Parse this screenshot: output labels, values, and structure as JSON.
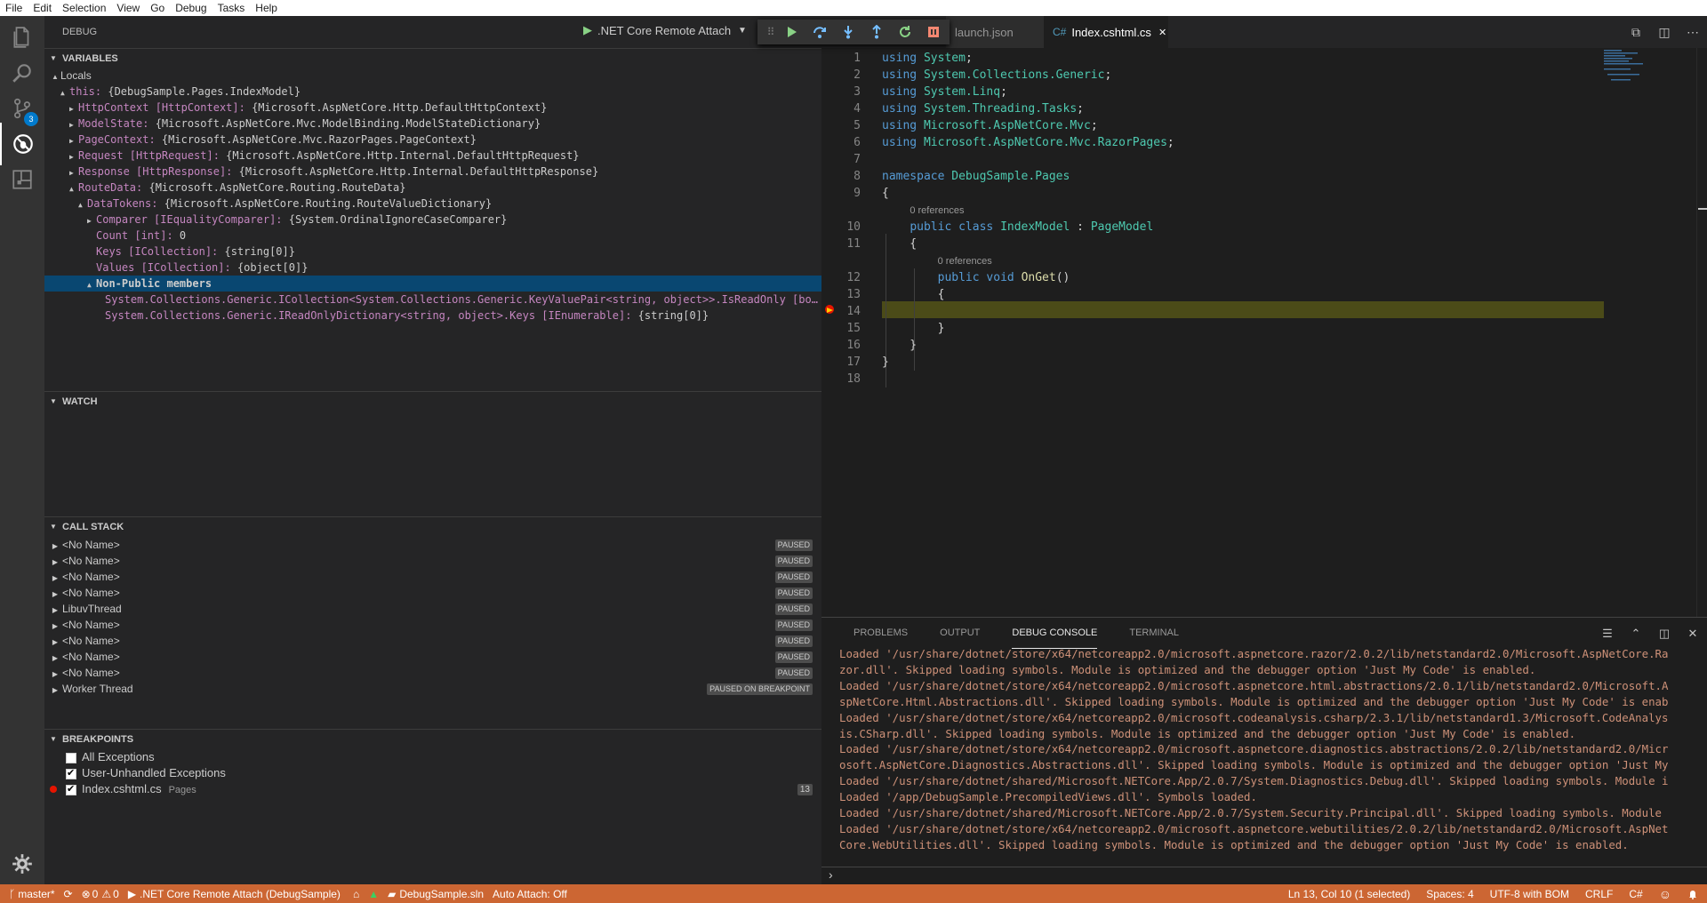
{
  "menu": [
    "File",
    "Edit",
    "Selection",
    "View",
    "Go",
    "Debug",
    "Tasks",
    "Help"
  ],
  "activity": {
    "scm_badge": "3"
  },
  "sidebar": {
    "title": "DEBUG",
    "launch_config": ".NET Core Remote Attach",
    "sections": {
      "variables": "VARIABLES",
      "watch": "WATCH",
      "callstack": "CALL STACK",
      "breakpoints": "BREAKPOINTS"
    },
    "variables": [
      {
        "indent": 0,
        "twisty": "▲",
        "name": "Locals",
        "value": "",
        "style": "scope"
      },
      {
        "indent": 1,
        "twisty": "▲",
        "name": "this:",
        "value": " {DebugSample.Pages.IndexModel}",
        "style": "prop"
      },
      {
        "indent": 2,
        "twisty": "▶",
        "name": "HttpContext [HttpContext]:",
        "value": " {Microsoft.AspNetCore.Http.DefaultHttpContext}",
        "style": "prop"
      },
      {
        "indent": 2,
        "twisty": "▶",
        "name": "ModelState:",
        "value": " {Microsoft.AspNetCore.Mvc.ModelBinding.ModelStateDictionary}",
        "style": "prop"
      },
      {
        "indent": 2,
        "twisty": "▶",
        "name": "PageContext:",
        "value": " {Microsoft.AspNetCore.Mvc.RazorPages.PageContext}",
        "style": "prop"
      },
      {
        "indent": 2,
        "twisty": "▶",
        "name": "Request [HttpRequest]:",
        "value": " {Microsoft.AspNetCore.Http.Internal.DefaultHttpRequest}",
        "style": "prop"
      },
      {
        "indent": 2,
        "twisty": "▶",
        "name": "Response [HttpResponse]:",
        "value": " {Microsoft.AspNetCore.Http.Internal.DefaultHttpResponse}",
        "style": "prop"
      },
      {
        "indent": 2,
        "twisty": "▲",
        "name": "RouteData:",
        "value": " {Microsoft.AspNetCore.Routing.RouteData}",
        "style": "prop"
      },
      {
        "indent": 3,
        "twisty": "▲",
        "name": "DataTokens:",
        "value": " {Microsoft.AspNetCore.Routing.RouteValueDictionary}",
        "style": "prop"
      },
      {
        "indent": 4,
        "twisty": "▶",
        "name": "Comparer [IEqualityComparer]:",
        "value": " {System.OrdinalIgnoreCaseComparer}",
        "style": "prop"
      },
      {
        "indent": 4,
        "twisty": "",
        "name": "Count [int]:",
        "value": " 0",
        "style": "prop"
      },
      {
        "indent": 4,
        "twisty": "",
        "name": "Keys [ICollection]:",
        "value": " {string[0]}",
        "style": "prop"
      },
      {
        "indent": 4,
        "twisty": "",
        "name": "Values [ICollection]:",
        "value": " {object[0]}",
        "style": "prop"
      },
      {
        "indent": 4,
        "twisty": "▲",
        "name": "Non-Public members",
        "value": "",
        "style": "selected"
      },
      {
        "indent": 5,
        "twisty": "",
        "name": "System.Collections.Generic.ICollection<System.Collections.Generic.KeyValuePair<string, object>>.IsReadOnly [bo…",
        "value": "",
        "style": "prop"
      },
      {
        "indent": 5,
        "twisty": "",
        "name": "System.Collections.Generic.IReadOnlyDictionary<string, object>.Keys [IEnumerable]:",
        "value": " {string[0]}",
        "style": "prop"
      }
    ],
    "callstack": [
      {
        "name": "<No Name>",
        "state": "PAUSED"
      },
      {
        "name": "<No Name>",
        "state": "PAUSED"
      },
      {
        "name": "<No Name>",
        "state": "PAUSED"
      },
      {
        "name": "<No Name>",
        "state": "PAUSED"
      },
      {
        "name": "LibuvThread",
        "state": "PAUSED"
      },
      {
        "name": "<No Name>",
        "state": "PAUSED"
      },
      {
        "name": "<No Name>",
        "state": "PAUSED"
      },
      {
        "name": "<No Name>",
        "state": "PAUSED"
      },
      {
        "name": "<No Name>",
        "state": "PAUSED"
      },
      {
        "name": "Worker Thread",
        "state": "PAUSED ON BREAKPOINT"
      }
    ],
    "breakpoints": [
      {
        "label": "All Exceptions",
        "checked": false,
        "dot": false,
        "path": "",
        "line": ""
      },
      {
        "label": "User-Unhandled Exceptions",
        "checked": true,
        "dot": false,
        "path": "",
        "line": ""
      },
      {
        "label": "Index.cshtml.cs",
        "checked": true,
        "dot": true,
        "path": "Pages",
        "line": "13"
      }
    ]
  },
  "editor": {
    "tabs": [
      {
        "label": "launch.json",
        "active": false
      },
      {
        "label": "Index.cshtml.cs",
        "active": true,
        "close": "✕",
        "icon": "C#"
      }
    ],
    "actions": [
      "⧉",
      "◫",
      "⋯"
    ],
    "lines": [
      {
        "n": "1",
        "html": "<span class='kw'>using</span> <span class='ty'>System</span>;"
      },
      {
        "n": "2",
        "html": "<span class='kw'>using</span> <span class='ty'>System.Collections.Generic</span>;"
      },
      {
        "n": "3",
        "html": "<span class='kw'>using</span> <span class='ty'>System.Linq</span>;"
      },
      {
        "n": "4",
        "html": "<span class='kw'>using</span> <span class='ty'>System.Threading.Tasks</span>;"
      },
      {
        "n": "5",
        "html": "<span class='kw'>using</span> <span class='ty'>Microsoft.AspNetCore.Mvc</span>;"
      },
      {
        "n": "6",
        "html": "<span class='kw'>using</span> <span class='ty'>Microsoft.AspNetCore.Mvc.RazorPages</span>;"
      },
      {
        "n": "7",
        "html": ""
      },
      {
        "n": "8",
        "html": "<span class='kw'>namespace</span> <span class='ty'>DebugSample.Pages</span>"
      },
      {
        "n": "9",
        "html": "{"
      },
      {
        "n": "",
        "html": "    <span class='codelens'>0 references</span>"
      },
      {
        "n": "10",
        "html": "    <span class='kw'>public</span> <span class='kw'>class</span> <span class='ty'>IndexModel</span> : <span class='ty'>PageModel</span>"
      },
      {
        "n": "11",
        "html": "    {"
      },
      {
        "n": "",
        "html": "        <span class='codelens'>0 references</span>"
      },
      {
        "n": "12",
        "html": "        <span class='kw'>public</span> <span class='kw'>void</span> <span class='fn'>OnGet</span>()"
      },
      {
        "n": "13",
        "html": "        {"
      },
      {
        "n": "14",
        "html": ""
      },
      {
        "n": "15",
        "html": "        }"
      },
      {
        "n": "16",
        "html": "    }"
      },
      {
        "n": "17",
        "html": "}"
      },
      {
        "n": "18",
        "html": ""
      }
    ]
  },
  "panel": {
    "tabs": [
      "PROBLEMS",
      "OUTPUT",
      "DEBUG CONSOLE",
      "TERMINAL"
    ],
    "active_tab": "DEBUG CONSOLE",
    "actions": [
      "☰",
      "⌃",
      "◫",
      "✕"
    ],
    "console_lines": [
      "Loaded '/usr/share/dotnet/store/x64/netcoreapp2.0/microsoft.aspnetcore.razor/2.0.2/lib/netstandard2.0/Microsoft.AspNetCore.Ra",
      "zor.dll'. Skipped loading symbols. Module is optimized and the debugger option 'Just My Code' is enabled.",
      "Loaded '/usr/share/dotnet/store/x64/netcoreapp2.0/microsoft.aspnetcore.html.abstractions/2.0.1/lib/netstandard2.0/Microsoft.A",
      "spNetCore.Html.Abstractions.dll'. Skipped loading symbols. Module is optimized and the debugger option 'Just My Code' is enab",
      "Loaded '/usr/share/dotnet/store/x64/netcoreapp2.0/microsoft.codeanalysis.csharp/2.3.1/lib/netstandard1.3/Microsoft.CodeAnalys",
      "is.CSharp.dll'. Skipped loading symbols. Module is optimized and the debugger option 'Just My Code' is enabled.",
      "Loaded '/usr/share/dotnet/store/x64/netcoreapp2.0/microsoft.aspnetcore.diagnostics.abstractions/2.0.2/lib/netstandard2.0/Micr",
      "osoft.AspNetCore.Diagnostics.Abstractions.dll'. Skipped loading symbols. Module is optimized and the debugger option 'Just My",
      "Loaded '/usr/share/dotnet/shared/Microsoft.NETCore.App/2.0.7/System.Diagnostics.Debug.dll'. Skipped loading symbols. Module i",
      "Loaded '/app/DebugSample.PrecompiledViews.dll'. Symbols loaded.",
      "Loaded '/usr/share/dotnet/shared/Microsoft.NETCore.App/2.0.7/System.Security.Principal.dll'. Skipped loading symbols. Module",
      "Loaded '/usr/share/dotnet/store/x64/netcoreapp2.0/microsoft.aspnetcore.webutilities/2.0.2/lib/netstandard2.0/Microsoft.AspNet",
      "Core.WebUtilities.dll'. Skipped loading symbols. Module is optimized and the debugger option 'Just My Code' is enabled."
    ],
    "prompt": "›"
  },
  "statusbar": {
    "branch": "master*",
    "sync": "⟳",
    "errors": "0",
    "warnings": "0",
    "debug_target": ".NET Core Remote Attach (DebugSample)",
    "solution": "DebugSample.sln",
    "auto_attach": "Auto Attach: Off",
    "position": "Ln 13, Col 10 (1 selected)",
    "spaces": "Spaces: 4",
    "encoding": "UTF-8 with BOM",
    "eol": "CRLF",
    "language": "C#",
    "smiley": "☺",
    "bell": "🔔",
    "color": "#cc6633"
  }
}
